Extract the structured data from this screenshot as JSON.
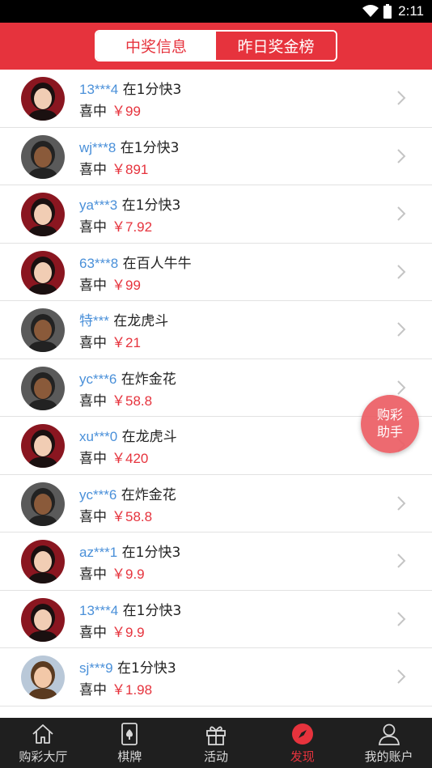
{
  "status_bar": {
    "time": "2:11",
    "icons": [
      "wifi-icon",
      "battery-icon"
    ]
  },
  "header": {
    "tabs": [
      {
        "label": "中奖信息",
        "active": true
      },
      {
        "label": "昨日奖金榜",
        "active": false
      }
    ]
  },
  "winners": [
    {
      "user": "13***4",
      "game": "在1分快3",
      "prefix": "喜中",
      "amount": "￥99",
      "avatar": "woman-avatar"
    },
    {
      "user": "wj***8",
      "game": "在1分快3",
      "prefix": "喜中",
      "amount": "￥891",
      "avatar": "man-avatar"
    },
    {
      "user": "ya***3",
      "game": "在1分快3",
      "prefix": "喜中",
      "amount": "￥7.92",
      "avatar": "woman-avatar"
    },
    {
      "user": "63***8",
      "game": "在百人牛牛",
      "prefix": "喜中",
      "amount": "￥99",
      "avatar": "woman-avatar"
    },
    {
      "user": "特***",
      "game": "在龙虎斗",
      "prefix": "喜中",
      "amount": "￥21",
      "avatar": "man-avatar"
    },
    {
      "user": "yc***6",
      "game": "在炸金花",
      "prefix": "喜中",
      "amount": "￥58.8",
      "avatar": "man-avatar"
    },
    {
      "user": "xu***0",
      "game": "在龙虎斗",
      "prefix": "喜中",
      "amount": "￥420",
      "avatar": "woman-avatar"
    },
    {
      "user": "yc***6",
      "game": "在炸金花",
      "prefix": "喜中",
      "amount": "￥58.8",
      "avatar": "man-avatar"
    },
    {
      "user": "az***1",
      "game": "在1分快3",
      "prefix": "喜中",
      "amount": "￥9.9",
      "avatar": "woman-avatar"
    },
    {
      "user": "13***4",
      "game": "在1分快3",
      "prefix": "喜中",
      "amount": "￥9.9",
      "avatar": "woman-avatar"
    },
    {
      "user": "sj***9",
      "game": "在1分快3",
      "prefix": "喜中",
      "amount": "￥1.98",
      "avatar": "child-avatar"
    }
  ],
  "fab": {
    "line1": "购彩",
    "line2": "助手"
  },
  "tabbar": {
    "items": [
      {
        "label": "购彩大厅",
        "icon": "home-icon",
        "active": false
      },
      {
        "label": "棋牌",
        "icon": "card-icon",
        "active": false
      },
      {
        "label": "活动",
        "icon": "gift-icon",
        "active": false
      },
      {
        "label": "发现",
        "icon": "compass-icon",
        "active": true
      },
      {
        "label": "我的账户",
        "icon": "user-icon",
        "active": false
      }
    ]
  },
  "colors": {
    "accent": "#e6333d",
    "username": "#4a90d9",
    "tabbar_bg": "#1f1f1f"
  }
}
